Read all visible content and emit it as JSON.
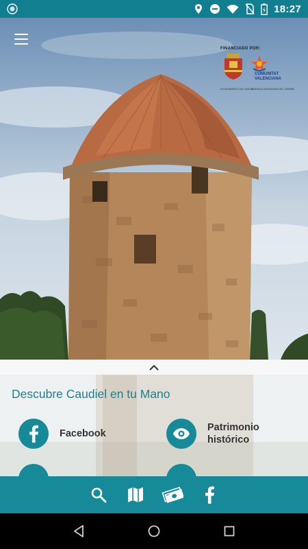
{
  "status_bar": {
    "time": "18:27",
    "icons": [
      "app-notification-icon",
      "location-icon",
      "do-not-disturb-icon",
      "wifi-icon",
      "no-sim-icon",
      "battery-charging-icon"
    ]
  },
  "header": {
    "menu_icon": "hamburger-menu-icon",
    "sponsor": {
      "title": "FINANCIADO POR:",
      "cv_label": "COMUNITAT\nVALENCIANA",
      "caption_left": "AYUNTAMIENTO DE CAUDIEL",
      "caption_right": "AGENCIA VALENCIANA DEL TURISME"
    }
  },
  "sheet": {
    "handle_icon": "chevron-up-icon",
    "title": "Descubre Caudiel en tu Mano",
    "tiles": [
      {
        "label": "Facebook",
        "icon": "facebook-icon"
      },
      {
        "label": "Patrimonio\nhistórico",
        "icon": "eye-icon"
      }
    ]
  },
  "bottom_nav": {
    "items": [
      "search-icon",
      "map-icon",
      "money-icon",
      "facebook-icon"
    ]
  },
  "system_nav": {
    "items": [
      "back-icon",
      "home-icon",
      "recents-icon"
    ]
  },
  "colors": {
    "status_bar": "#117f8f",
    "accent": "#168a99",
    "title_text": "#1f7f8b"
  }
}
